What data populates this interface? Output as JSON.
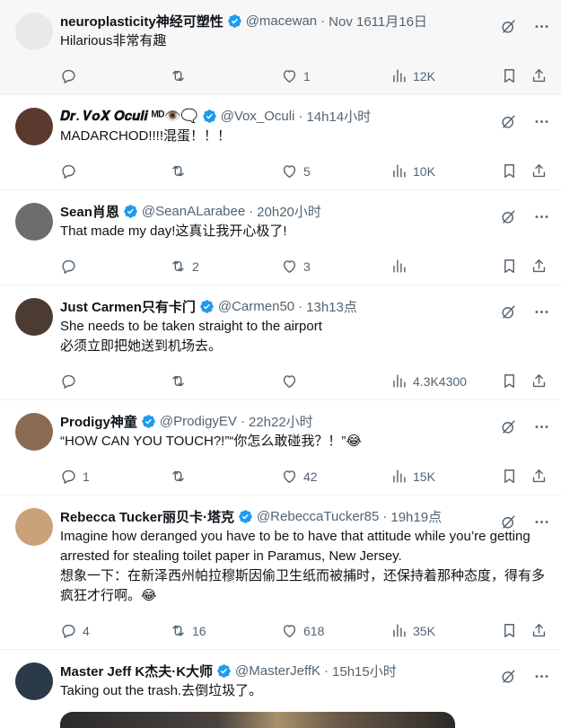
{
  "tweets": [
    {
      "name": "neuroplasticity神经可塑性",
      "handle": "@macewan",
      "time": "Nov 1611月16日",
      "text": [
        "Hilarious非常有趣"
      ],
      "stats": {
        "reply": "",
        "retweet": "",
        "like": "1",
        "views": "12K"
      },
      "avatar_color": "#e9e9e9",
      "highlight": true
    },
    {
      "name": "𝑫𝒓. 𝑽𝒐𝑿 𝑶𝒄𝒖𝒍𝒊 ᴹᴰ👁️🗨️",
      "handle": "@Vox_Oculi",
      "time": "14h14小时",
      "text": [
        "MADARCHOD!!!!混蛋！！！"
      ],
      "stats": {
        "reply": "",
        "retweet": "",
        "like": "5",
        "views": "10K"
      },
      "avatar_color": "#5a3a2e"
    },
    {
      "name": "Sean肖恩",
      "handle": "@SeanALarabee",
      "time": "20h20小时",
      "text": [
        "That made my day!这真让我开心极了!"
      ],
      "stats": {
        "reply": "",
        "retweet": "2",
        "like": "3",
        "views": ""
      },
      "avatar_color": "#6d6d6d"
    },
    {
      "name": "Just Carmen只有卡门",
      "handle": "@Carmen50",
      "time": "13h13点",
      "text": [
        "She needs to be taken straight to the airport",
        "必须立即把她送到机场去。"
      ],
      "stats": {
        "reply": "",
        "retweet": "",
        "like": "",
        "views": "4.3K4300"
      },
      "avatar_color": "#4b3b33"
    },
    {
      "name": "Prodigy神童",
      "handle": "@ProdigyEV",
      "time": "22h22小时",
      "text": [
        "“HOW CAN YOU TOUCH?!”“你怎么敢碰我？！”😂"
      ],
      "stats": {
        "reply": "1",
        "retweet": "",
        "like": "42",
        "views": "15K"
      },
      "avatar_color": "#8a6a52"
    },
    {
      "name": "Rebecca Tucker丽贝卡·塔克",
      "handle": "@RebeccaTucker85",
      "time": "19h19点",
      "text": [
        "Imagine how deranged you have to be to have that attitude while you’re getting arrested for stealing toilet paper in Paramus, New Jersey.",
        "想象一下：在新泽西州帕拉穆斯因偷卫生纸而被捕时，还保持着那种态度，得有多疯狂才行啊。😂"
      ],
      "stats": {
        "reply": "4",
        "retweet": "16",
        "like": "618",
        "views": "35K"
      },
      "avatar_color": "#c9a27a"
    },
    {
      "name": "Master Jeff K杰夫·K大师",
      "handle": "@MasterJeffK",
      "time": "15h15小时",
      "text": [
        "Taking out the trash.去倒垃圾了。"
      ],
      "stats": {
        "reply": "",
        "retweet": "",
        "like": "",
        "views": ""
      },
      "avatar_color": "#2b3a4a",
      "has_media": true
    }
  ],
  "icons": {
    "verified": "verified-badge-icon",
    "grok": "grok-icon",
    "more": "more-dots-icon",
    "reply": "reply-icon",
    "retweet": "retweet-icon",
    "like": "heart-icon",
    "views": "views-chart-icon",
    "bookmark": "bookmark-icon",
    "share": "share-icon"
  },
  "colors": {
    "verified": "#1d9bf0",
    "muted": "#536471",
    "text": "#0f1419"
  }
}
